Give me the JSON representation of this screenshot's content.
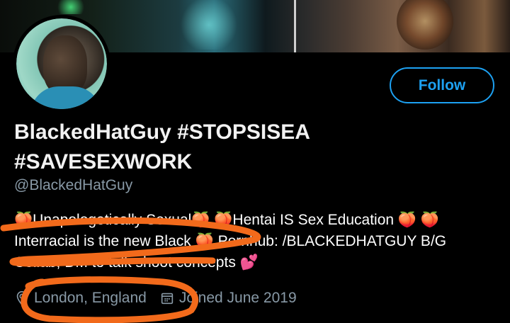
{
  "profile": {
    "name_line1": "BlackedHatGuy #STOPSISEA",
    "name_line2": "#SAVESEXWORK",
    "handle": "@BlackedHatGuy",
    "follow_label": "Follow",
    "bio_line1": "🍑Unapologetically Sexual🍑 🍑Hentai IS Sex Education 🍑 🍑",
    "bio_line2": "Interracial is the new Black 🍑 Pornhub: /BLACKEDHATGUY  B/G",
    "bio_line3": "Collab, DM to talk shoot concepts 💕",
    "location": "London, England",
    "joined": "Joined June 2019"
  },
  "icons": {
    "location": "location-pin-icon",
    "calendar": "calendar-icon"
  },
  "colors": {
    "accent": "#1da1f2",
    "secondary_text": "#8899a6",
    "background": "#000000",
    "scribble": "#f26a1b"
  }
}
